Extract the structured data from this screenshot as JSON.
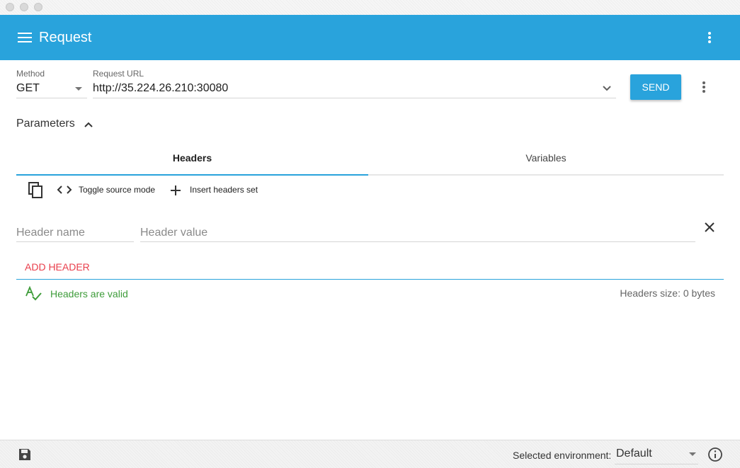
{
  "appbar": {
    "title": "Request"
  },
  "request": {
    "method_label": "Method",
    "method_value": "GET",
    "url_label": "Request URL",
    "url_value": "http://35.224.26.210:30080",
    "send_label": "SEND"
  },
  "parameters": {
    "label": "Parameters"
  },
  "tabs": [
    {
      "label": "Headers",
      "active": true
    },
    {
      "label": "Variables",
      "active": false
    }
  ],
  "toolbar": {
    "toggle_source_label": "Toggle source mode",
    "insert_headers_label": "Insert headers set"
  },
  "header_row": {
    "name_placeholder": "Header name",
    "value_placeholder": "Header value"
  },
  "add_header_label": "ADD HEADER",
  "status": {
    "valid_text": "Headers are valid",
    "size_text": "Headers size: 0 bytes"
  },
  "footer": {
    "env_label": "Selected environment:",
    "env_value": "Default"
  },
  "colors": {
    "accent": "#29a3dc",
    "add_header": "#e93e4b",
    "valid": "#3e9c3a"
  },
  "icons": [
    "menu-icon",
    "more-vert-icon",
    "chevron-down-icon",
    "chevron-up-icon",
    "copy-icon",
    "code-icon",
    "plus-icon",
    "close-icon",
    "spellcheck-icon",
    "save-icon",
    "info-icon"
  ]
}
